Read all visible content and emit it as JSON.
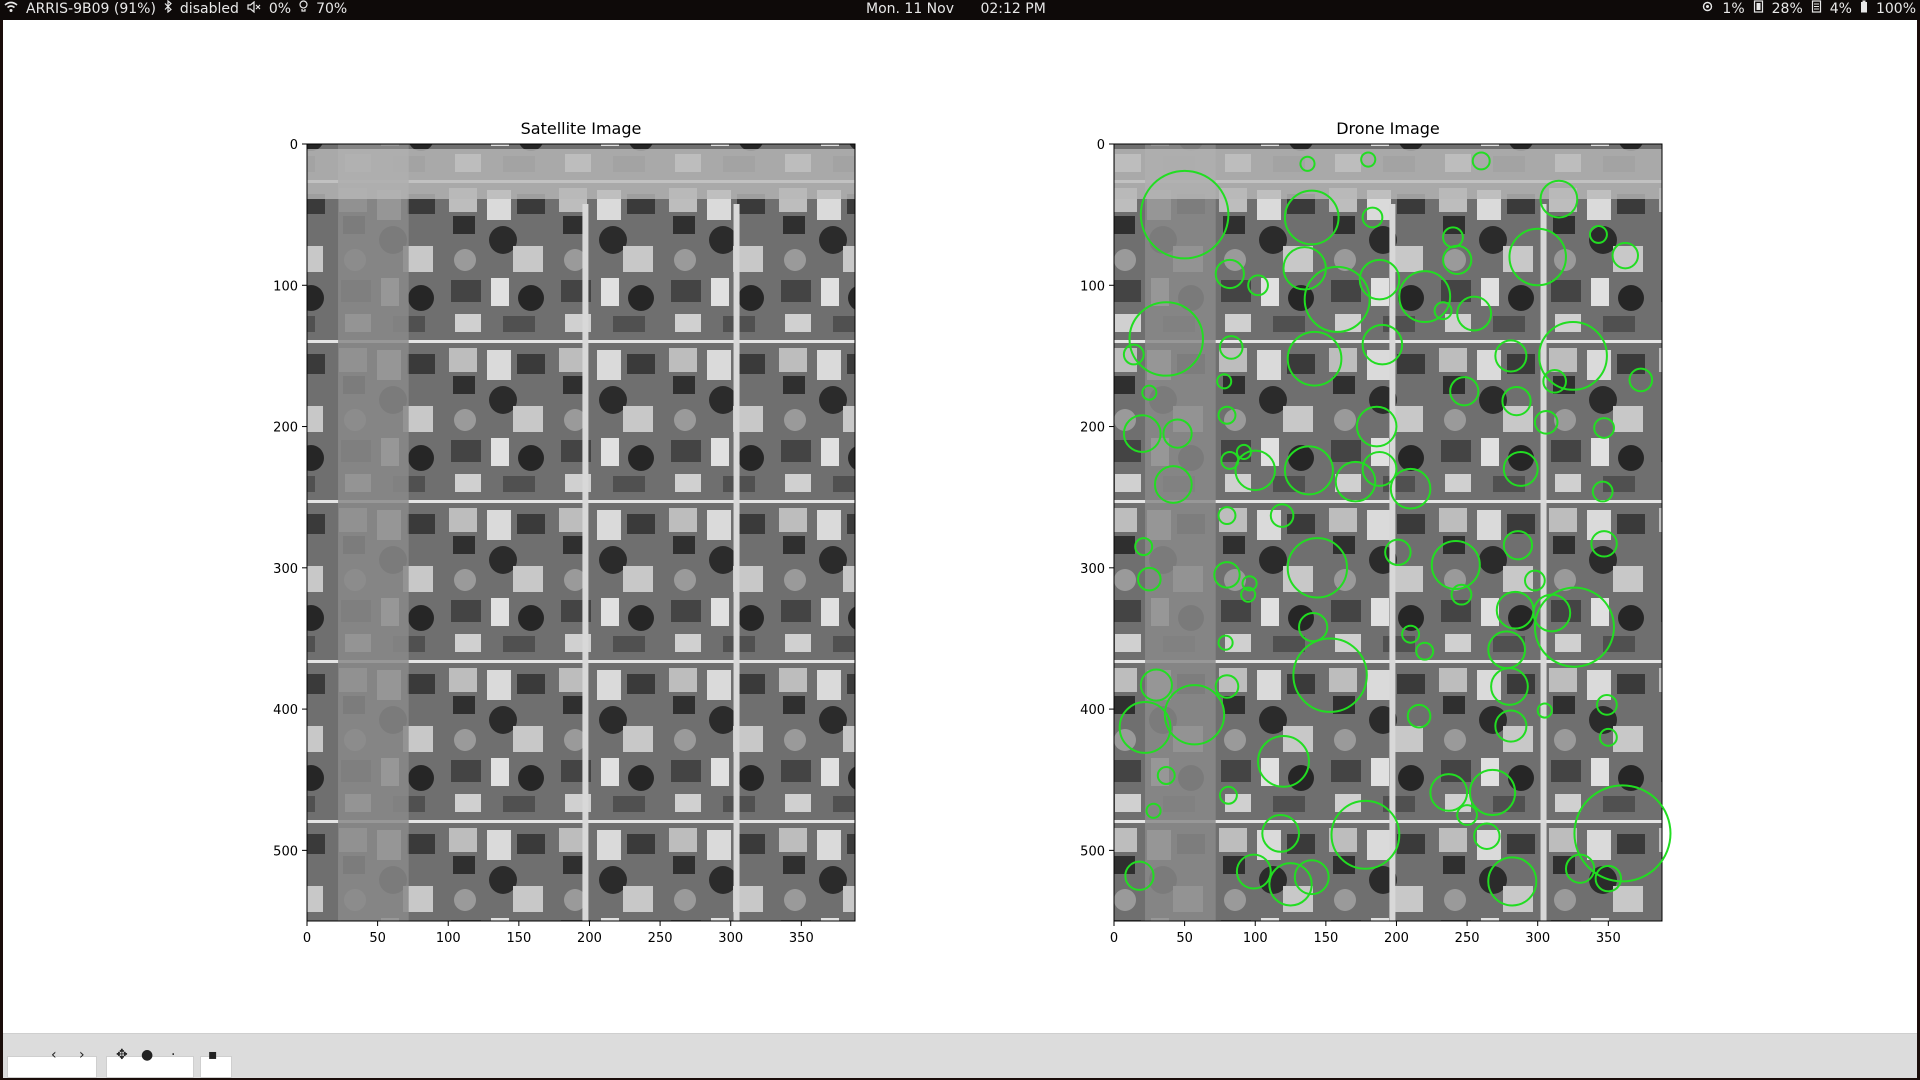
{
  "status_bar": {
    "wifi": "ARRIS-9B09 (91%)",
    "bluetooth": "disabled",
    "volume": "0%",
    "brightness": "70%",
    "date": "Mon. 11 Nov",
    "time": "02:12 PM",
    "cpu": "1%",
    "memory": "28%",
    "disk": "4%",
    "battery": "100%"
  },
  "figure": {
    "left_title": "Satellite Image",
    "right_title": "Drone Image",
    "x_ticks": [
      "0",
      "50",
      "100",
      "150",
      "200",
      "250",
      "300",
      "350"
    ],
    "y_ticks": [
      "0",
      "100",
      "200",
      "300",
      "400",
      "500"
    ],
    "circle_color": "#22dd22"
  },
  "detections": [
    [
      50,
      50,
      31
    ],
    [
      140,
      52,
      19
    ],
    [
      183,
      52,
      7
    ],
    [
      240,
      66,
      7
    ],
    [
      243,
      82,
      10
    ],
    [
      137,
      14,
      5
    ],
    [
      180,
      11,
      5
    ],
    [
      260,
      12,
      6
    ],
    [
      315,
      39,
      13
    ],
    [
      300,
      80,
      20
    ],
    [
      343,
      64,
      6
    ],
    [
      362,
      79,
      9
    ],
    [
      82,
      92,
      10
    ],
    [
      102,
      100,
      7
    ],
    [
      135,
      88,
      15
    ],
    [
      158,
      110,
      23
    ],
    [
      188,
      96,
      14
    ],
    [
      220,
      108,
      18
    ],
    [
      233,
      118,
      6
    ],
    [
      255,
      120,
      12
    ],
    [
      190,
      142,
      14
    ],
    [
      142,
      152,
      19
    ],
    [
      37,
      138,
      26
    ],
    [
      83,
      144,
      8
    ],
    [
      14,
      149,
      7
    ],
    [
      25,
      176,
      5
    ],
    [
      78,
      168,
      5
    ],
    [
      281,
      150,
      11
    ],
    [
      325,
      150,
      24
    ],
    [
      312,
      168,
      8
    ],
    [
      248,
      175,
      10
    ],
    [
      285,
      182,
      10
    ],
    [
      373,
      167,
      8
    ],
    [
      80,
      192,
      6
    ],
    [
      186,
      200,
      14
    ],
    [
      20,
      205,
      13
    ],
    [
      45,
      205,
      10
    ],
    [
      306,
      197,
      8
    ],
    [
      347,
      201,
      7
    ],
    [
      92,
      218,
      5
    ],
    [
      82,
      224,
      6
    ],
    [
      100,
      231,
      14
    ],
    [
      138,
      231,
      17
    ],
    [
      171,
      239,
      14
    ],
    [
      188,
      230,
      12
    ],
    [
      210,
      244,
      14
    ],
    [
      288,
      230,
      12
    ],
    [
      42,
      241,
      13
    ],
    [
      346,
      246,
      7
    ],
    [
      80,
      263,
      6
    ],
    [
      119,
      263,
      8
    ],
    [
      286,
      284,
      10
    ],
    [
      21,
      285,
      6
    ],
    [
      347,
      283,
      9
    ],
    [
      201,
      289,
      9
    ],
    [
      144,
      300,
      21
    ],
    [
      242,
      298,
      17
    ],
    [
      25,
      308,
      8
    ],
    [
      80,
      305,
      9
    ],
    [
      96,
      311,
      5
    ],
    [
      298,
      309,
      7
    ],
    [
      246,
      319,
      7
    ],
    [
      95,
      319,
      5
    ],
    [
      284,
      330,
      13
    ],
    [
      310,
      332,
      13
    ],
    [
      326,
      342,
      28
    ],
    [
      141,
      342,
      10
    ],
    [
      210,
      347,
      6
    ],
    [
      220,
      359,
      6
    ],
    [
      278,
      358,
      13
    ],
    [
      79,
      353,
      5
    ],
    [
      153,
      376,
      26
    ],
    [
      30,
      383,
      11
    ],
    [
      280,
      384,
      13
    ],
    [
      80,
      384,
      8
    ],
    [
      57,
      404,
      21
    ],
    [
      349,
      397,
      7
    ],
    [
      305,
      401,
      5
    ],
    [
      216,
      405,
      8
    ],
    [
      22,
      413,
      18
    ],
    [
      281,
      412,
      11
    ],
    [
      350,
      420,
      6
    ],
    [
      120,
      437,
      18
    ],
    [
      37,
      447,
      6
    ],
    [
      237,
      459,
      13
    ],
    [
      268,
      459,
      16
    ],
    [
      81,
      461,
      6
    ],
    [
      28,
      472,
      5
    ],
    [
      250,
      475,
      7
    ],
    [
      118,
      488,
      13
    ],
    [
      178,
      489,
      24
    ],
    [
      264,
      490,
      9
    ],
    [
      360,
      488,
      34
    ],
    [
      99,
      515,
      12
    ],
    [
      140,
      519,
      12
    ],
    [
      18,
      518,
      10
    ],
    [
      330,
      513,
      10
    ],
    [
      350,
      520,
      9
    ],
    [
      125,
      524,
      15
    ],
    [
      282,
      522,
      17
    ]
  ]
}
